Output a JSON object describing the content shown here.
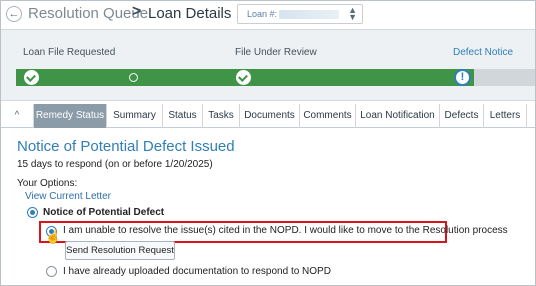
{
  "header": {
    "back_icon": "arrow-left-icon",
    "breadcrumb": "Resolution Queue",
    "separator": ">",
    "title": "Loan Details",
    "loan_select": {
      "label": "Loan #:",
      "arrows_icon": "chevron-up-down-icon"
    }
  },
  "progress": {
    "steps": [
      {
        "label": "Loan File Requested",
        "status": "complete"
      },
      {
        "label": "",
        "status": "pending"
      },
      {
        "label": "File Under Review",
        "status": "complete"
      },
      {
        "label": "Defect Notice",
        "status": "current"
      }
    ],
    "fill_fraction": 0.88,
    "colors": {
      "complete": "#3f9447",
      "current": "#2f7fb8",
      "track": "#d1d6da"
    }
  },
  "tabs": {
    "collapse_icon": "^",
    "items": [
      "Remedy Status",
      "Summary",
      "Status",
      "Tasks",
      "Documents",
      "Comments",
      "Loan Notification",
      "Defects",
      "Letters"
    ],
    "active": "Remedy Status"
  },
  "content": {
    "title": "Notice of Potential Defect Issued",
    "subtitle": "15 days to respond (on or before 1/20/2025)",
    "options_label": "Your Options:",
    "view_letter_link": "View Current Letter",
    "option_group": {
      "label": "Notice of Potential Defect",
      "selected": true,
      "choices": [
        {
          "label": "I am unable to resolve the issue(s) cited in the NOPD. I would like to move to the Resolution process",
          "selected": true,
          "highlighted": true
        },
        {
          "label": "I have already uploaded documentation to respond to NOPD",
          "selected": false
        }
      ]
    },
    "send_button": "Send Resolution Request",
    "highlight_color": "#d9141b"
  }
}
